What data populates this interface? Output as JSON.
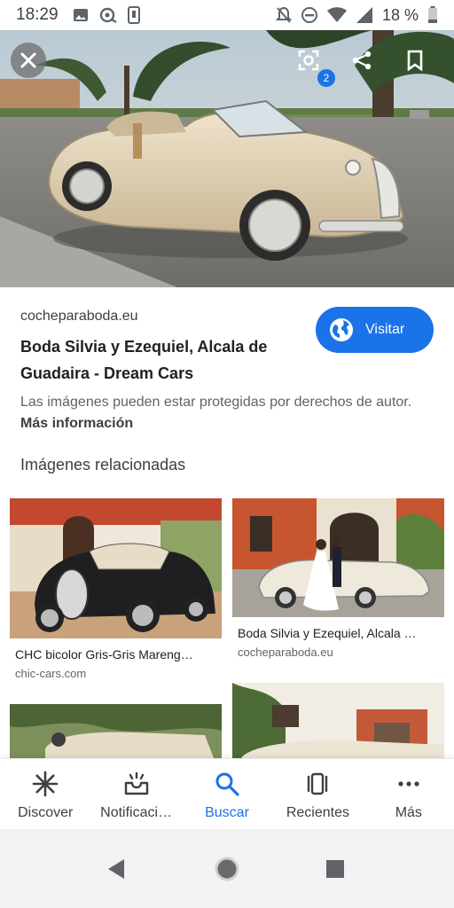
{
  "status_bar": {
    "time": "18:29",
    "battery_text": "18 %",
    "icons": [
      "image-icon",
      "assistant-icon",
      "phone-vibrate-icon",
      "notifications-off-icon",
      "dnd-icon",
      "wifi-icon",
      "signal-icon",
      "battery-icon"
    ]
  },
  "hero": {
    "lens_badge": "2",
    "icons": [
      "close-icon",
      "lens-icon",
      "share-icon",
      "bookmark-icon"
    ]
  },
  "result": {
    "domain": "cocheparaboda.eu",
    "title": "Boda Silvia y Ezequiel, Alcala de Guadaira - Dream Cars",
    "visit_label": "Visitar",
    "notice_text": "Las imágenes pueden estar protegidas por derechos de autor.",
    "notice_link": "Más información"
  },
  "related": {
    "heading": "Imágenes relacionadas",
    "items": [
      {
        "caption": "CHC bicolor Gris-Gris Mareng…",
        "domain": "chic-cars.com"
      },
      {
        "caption": "Boda Silvia y Ezequiel, Alcala …",
        "domain": "cocheparaboda.eu"
      }
    ]
  },
  "bottom_nav": {
    "items": [
      {
        "label": "Discover",
        "icon": "asterisk-icon"
      },
      {
        "label": "Notificaci…",
        "icon": "inbox-icon"
      },
      {
        "label": "Buscar",
        "icon": "search-icon"
      },
      {
        "label": "Recientes",
        "icon": "tabs-icon"
      },
      {
        "label": "Más",
        "icon": "more-icon"
      }
    ],
    "active_index": 2
  },
  "colors": {
    "accent": "#1a73e8",
    "car_beige": "#dccdb2",
    "car_black": "#1f1f22"
  }
}
